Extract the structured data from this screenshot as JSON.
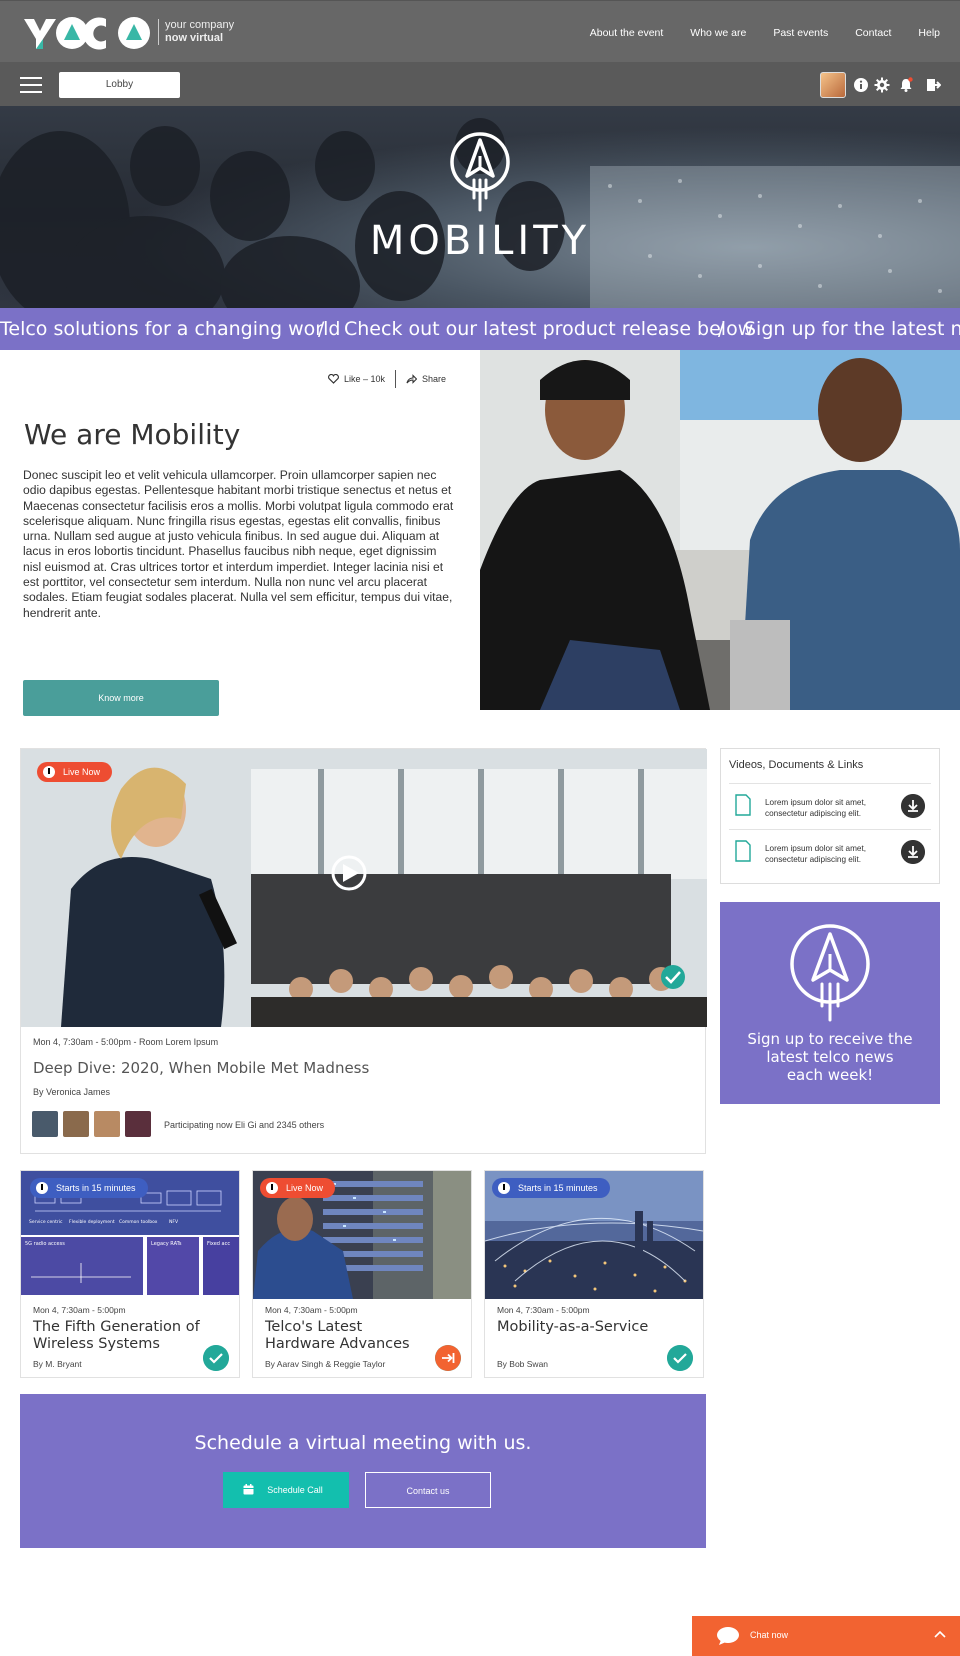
{
  "brand": {
    "logo_text": "YOCO",
    "tagline_line1": "your company",
    "tagline_line2": "now virtual",
    "colors": {
      "header": "#676767",
      "toolbar": "#5a5a5a",
      "purple": "#7b71c7",
      "teal": "#4a9e9a",
      "orange": "#f26331",
      "live_red": "#ee4d32",
      "soon_blue": "#3e5ec1",
      "check_green": "#22a899"
    }
  },
  "nav": {
    "items": [
      "About the event",
      "Who we are",
      "Past events",
      "Contact",
      "Help"
    ]
  },
  "toolbar": {
    "menu_icon": "hamburger-icon",
    "location": "Lobby",
    "icons": [
      "info-icon",
      "gear-icon",
      "bell-icon",
      "logout-icon"
    ]
  },
  "hero": {
    "title": "MOBILITY",
    "icon": "rocket-icon"
  },
  "ticker": {
    "items": [
      "Telco solutions for a changing world",
      "Check out our latest product release below",
      "Sign up for the latest news"
    ],
    "separator": "/"
  },
  "about": {
    "like_label": "Like – 10k",
    "share_label": "Share",
    "title": "We are Mobility",
    "body": "Donec suscipit leo et velit vehicula ullamcorper. Proin ullamcorper sapien nec odio dapibus egestas. Pellentesque habitant morbi tristique senectus et netus et Maecenas consectetur facilisis eros a mollis. Morbi volutpat ligula commodo erat scelerisque aliquam. Nunc fringilla risus egestas, egestas elit convallis, finibus urna. Nullam sed augue at justo vehicula finibus. In sed augue dui. Aliquam at lacus in eros lobortis tincidunt. Phasellus faucibus nibh neque, eget dignissim nisl euismod at. Cras ultrices tortor et interdum imperdiet. Integer lacinia nisi et est porttitor, vel consectetur sem interdum. Nulla non nunc vel arcu placerat sodales. Etiam feugiat sodales placerat. Nulla vel sem efficitur, tempus dui vitae, hendrerit ante.",
    "button": "Know more"
  },
  "feature": {
    "badge": "Live Now",
    "meta": "Mon 4, 7:30am - 5:00pm  -  Room Lorem Ipsum",
    "title": "Deep Dive: 2020, When Mobile Met Madness",
    "by": "By Veronica James",
    "participants": "Participating now Eli Gi and 2345 others"
  },
  "docs": {
    "title": "Videos, Documents & Links",
    "items": [
      {
        "text": "Lorem ipsum dolor sit amet, consectetur adipiscing elit."
      },
      {
        "text": "Lorem ipsum dolor sit amet, consectetur adipiscing elit."
      }
    ]
  },
  "signup": {
    "text": "Sign up to receive the latest telco news each week!"
  },
  "cards": [
    {
      "badge": "Starts in 15 minutes",
      "meta": "Mon 4, 7:30am - 5:00pm",
      "title": "The Fifth Generation of Wireless Systems",
      "by": "By M. Bryant",
      "status": "check",
      "diagram_labels": [
        "Service centric",
        "Flexible deployment",
        "Common toolbox",
        "NFV",
        "5G radio access",
        "Legacy RATs",
        "Fixed acc"
      ]
    },
    {
      "badge": "Live Now",
      "meta": "Mon 4, 7:30am - 5:00pm",
      "title": "Telco's Latest Hardware Advances",
      "by": "By Aarav Singh & Reggie Taylor",
      "status": "enter"
    },
    {
      "badge": "Starts in 15 minutes",
      "meta": "Mon 4, 7:30am - 5:00pm",
      "title": "Mobility-as-a-Service",
      "by": "By Bob Swan",
      "status": "check"
    }
  ],
  "schedule": {
    "title": "Schedule a virtual meeting with us.",
    "call_button": "Schedule Call",
    "contact_button": "Contact us"
  },
  "chat": {
    "label": "Chat now"
  }
}
